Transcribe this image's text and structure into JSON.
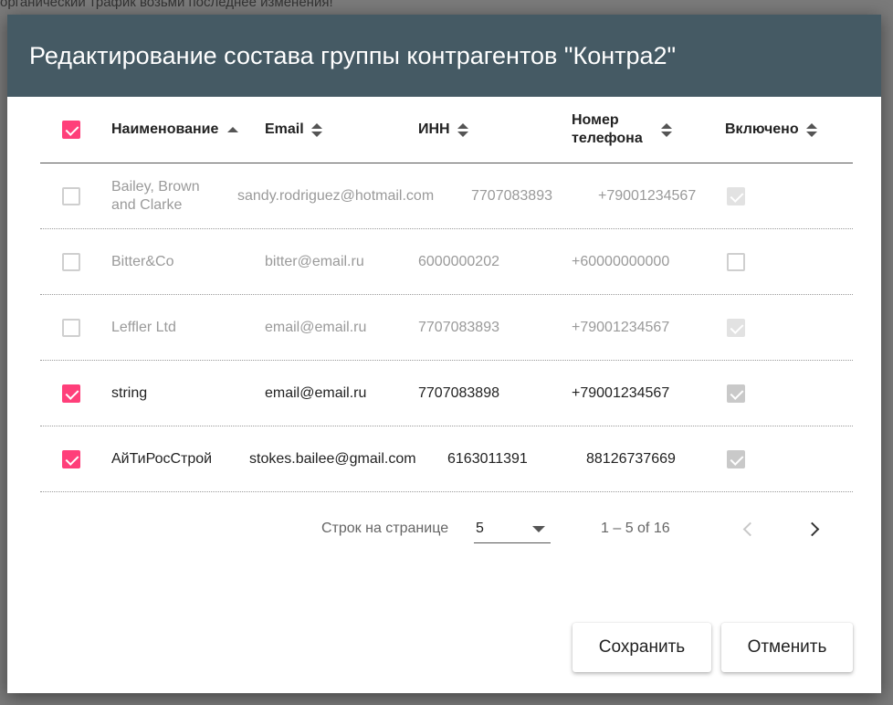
{
  "background": {
    "text": "органический трафик возьми последнее изменения!"
  },
  "dialog": {
    "title": "Редактирование состава группы контрагентов \"Контра2\""
  },
  "table": {
    "headers": {
      "name": "Наименование",
      "email": "Email",
      "inn": "ИНН",
      "phone": "Номер телефона",
      "included": "Включено"
    },
    "rows": [
      {
        "selected": false,
        "name": "Bailey, Brown and Clarke",
        "email": "sandy.rodriguez@hotmail.com",
        "inn": "7707083893",
        "phone": "+79001234567",
        "included": true,
        "disabled": true
      },
      {
        "selected": false,
        "name": "Bitter&Co",
        "email": "bitter@email.ru",
        "inn": "6000000202",
        "phone": "+60000000000",
        "included": false,
        "disabled": true
      },
      {
        "selected": false,
        "name": "Leffler Ltd",
        "email": "email@email.ru",
        "inn": "7707083893",
        "phone": "+79001234567",
        "included": true,
        "disabled": true
      },
      {
        "selected": true,
        "name": "string",
        "email": "email@email.ru",
        "inn": "7707083898",
        "phone": "+79001234567",
        "included": true,
        "disabled": false
      },
      {
        "selected": true,
        "name": "АйТиРосСтрой",
        "email": "stokes.bailee@gmail.com",
        "inn": "6163011391",
        "phone": "88126737669",
        "included": true,
        "disabled": false
      }
    ]
  },
  "pagination": {
    "rows_per_page_label": "Строк на странице",
    "rows_per_page_value": "5",
    "range": "1 – 5 of 16"
  },
  "actions": {
    "save_label": "Сохранить",
    "cancel_label": "Отменить"
  },
  "colors": {
    "header_bg": "#455a64",
    "accent": "#ff3f7a"
  }
}
